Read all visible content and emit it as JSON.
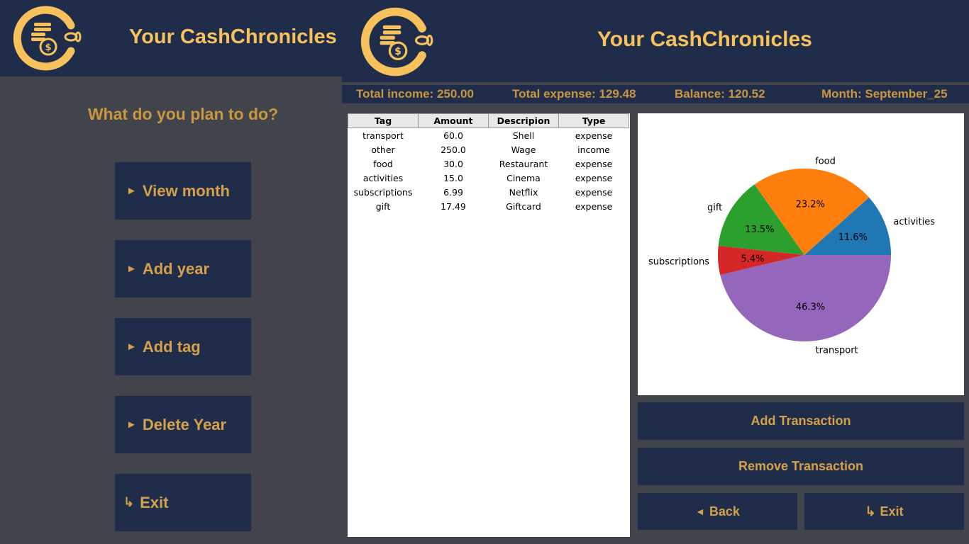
{
  "left_window": {
    "title": "Your CashChronicles",
    "question": "What do you plan to do?",
    "menu": [
      {
        "icon": "play-arrow-icon",
        "glyph": "►",
        "label": "View month"
      },
      {
        "icon": "play-arrow-icon",
        "glyph": "►",
        "label": "Add year"
      },
      {
        "icon": "play-arrow-icon",
        "glyph": "►",
        "label": "Add tag"
      },
      {
        "icon": "play-arrow-icon",
        "glyph": "►",
        "label": "Delete Year"
      },
      {
        "icon": "exit-arrow-icon",
        "glyph": "↳",
        "label": "Exit"
      }
    ]
  },
  "right_window": {
    "title": "Your CashChronicles",
    "stats": {
      "income": "Total income: 250.00",
      "expense": "Total expense: 129.48",
      "balance": "Balance: 120.52",
      "month": "Month: September_25"
    },
    "table": {
      "columns": [
        "Tag",
        "Amount",
        "Descripion",
        "Type"
      ],
      "rows": [
        [
          "transport",
          "60.0",
          "Shell",
          "expense"
        ],
        [
          "other",
          "250.0",
          "Wage",
          "income"
        ],
        [
          "food",
          "30.0",
          "Restaurant",
          "expense"
        ],
        [
          "activities",
          "15.0",
          "Cinema",
          "expense"
        ],
        [
          "subscriptions",
          "6.99",
          "Netflix",
          "expense"
        ],
        [
          "gift",
          "17.49",
          "Giftcard",
          "expense"
        ]
      ]
    },
    "buttons": {
      "add": "Add Transaction",
      "remove": "Remove Transaction",
      "back_glyph": "◄",
      "back": "Back",
      "exit_glyph": "↳",
      "exit": "Exit"
    }
  },
  "colors": {
    "header_bg": "#1f2d4b",
    "accent_gold": "#f7c25c",
    "button_text": "#d4a14a",
    "background": "#41454b"
  },
  "chart_data": {
    "type": "pie",
    "title": "",
    "categories": [
      "activities",
      "food",
      "gift",
      "subscriptions",
      "transport"
    ],
    "values": [
      11.6,
      23.2,
      13.5,
      5.4,
      46.3
    ],
    "labels": [
      "11.6%",
      "23.2%",
      "13.5%",
      "5.4%",
      "46.3%"
    ],
    "colors": [
      "#1f77b4",
      "#ff7f0e",
      "#2ca02c",
      "#d62728",
      "#9467bd"
    ]
  }
}
